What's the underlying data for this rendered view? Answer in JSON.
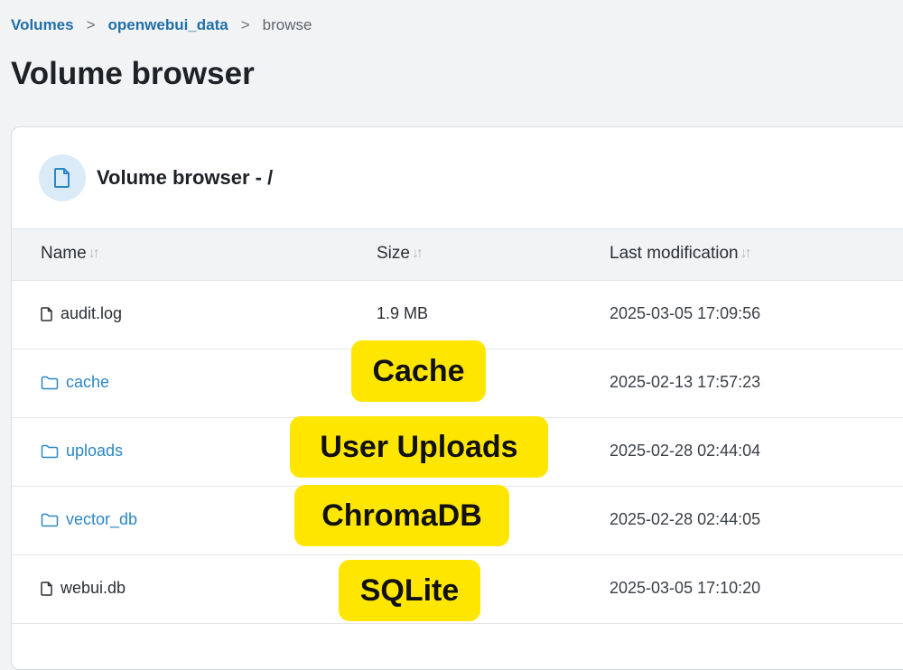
{
  "breadcrumb": {
    "items": [
      "Volumes",
      "openwebui_data"
    ],
    "separator": ">",
    "current": "browse"
  },
  "page_title": "Volume browser",
  "card": {
    "title": "Volume browser - /",
    "icon": "file-icon"
  },
  "table": {
    "columns": [
      "Name",
      "Size",
      "Last modification"
    ],
    "sort_glyph": "↓↑",
    "rows": [
      {
        "name": "audit.log",
        "type": "file",
        "size": "1.9 MB",
        "modified": "2025-03-05 17:09:56"
      },
      {
        "name": "cache",
        "type": "folder",
        "size": "",
        "modified": "2025-02-13 17:57:23"
      },
      {
        "name": "uploads",
        "type": "folder",
        "size": "",
        "modified": "2025-02-28 02:44:04"
      },
      {
        "name": "vector_db",
        "type": "folder",
        "size": "",
        "modified": "2025-02-28 02:44:05"
      },
      {
        "name": "webui.db",
        "type": "file",
        "size": "",
        "modified": "2025-03-05 17:10:20"
      }
    ]
  },
  "annotations": [
    "Cache",
    "User Uploads",
    "ChromaDB",
    "SQLite"
  ],
  "colors": {
    "link": "#2a86c5",
    "highlight": "#ffe600",
    "icon_bg": "#dbeaf7"
  }
}
